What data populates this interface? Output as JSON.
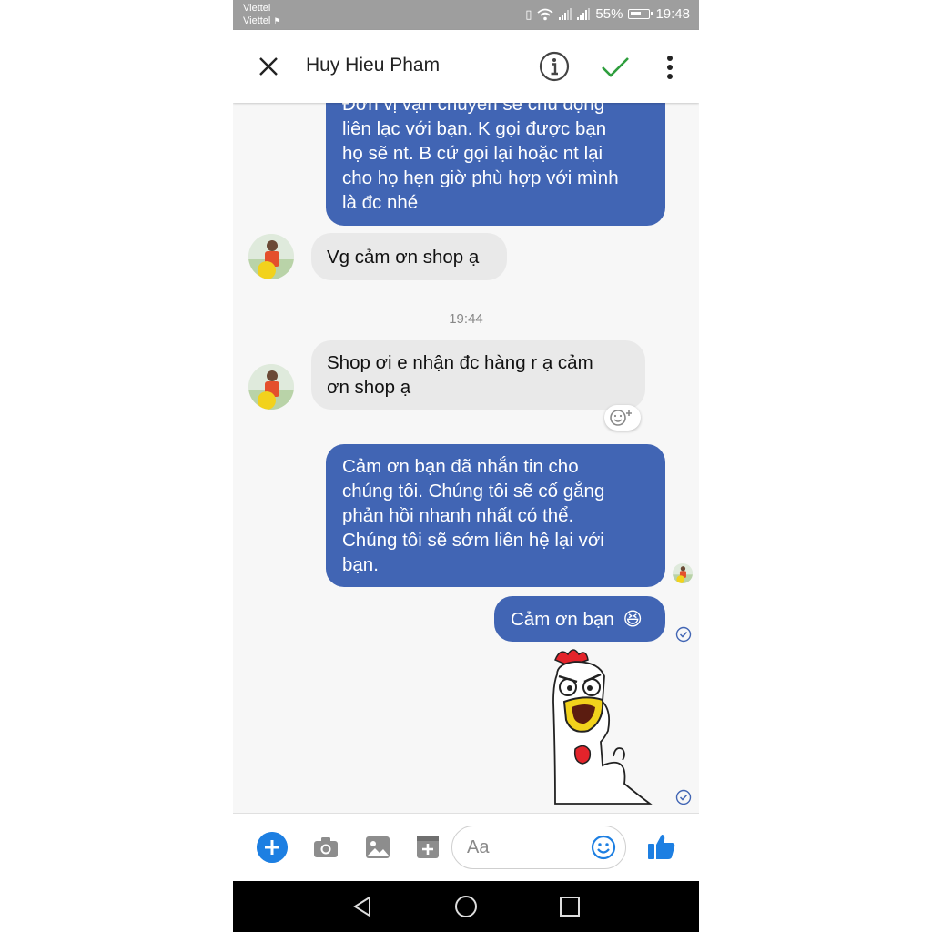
{
  "status_bar": {
    "carrier_1": "Viettel",
    "carrier_2": "Viettel",
    "battery": "55%",
    "time": "19:48"
  },
  "header": {
    "contact_name": "Huy Hieu Pham"
  },
  "messages": [
    {
      "side": "outgoing",
      "text": [
        "Đơn vị vận chuyển sẽ chủ động",
        "liên lạc với bạn. K gọi được bạn",
        "họ sẽ nt. B cứ gọi lại hoặc nt lại",
        "cho họ hẹn giờ phù hợp với mình",
        "là đc nhé"
      ]
    },
    {
      "side": "incoming",
      "text": [
        "Vg cảm ơn shop ạ"
      ]
    },
    {
      "side": "incoming",
      "text": [
        "Shop ơi e nhận đc hàng r ạ cảm",
        "ơn shop ạ"
      ]
    },
    {
      "side": "outgoing",
      "text": [
        "Cảm ơn bạn đã nhắn tin cho",
        "chúng tôi. Chúng tôi sẽ cố gắng",
        "phản hồi nhanh nhất có thể.",
        "Chúng tôi sẽ sớm liên hệ lại với",
        "bạn."
      ]
    },
    {
      "side": "outgoing",
      "text": [
        "Cảm ơn bạn"
      ],
      "emoji": "😆"
    }
  ],
  "timestamp": "19:44",
  "composer": {
    "placeholder": "Aa"
  },
  "colors": {
    "outgoing_bubble": "#4165b4",
    "incoming_bubble": "#e9e9e9",
    "accent": "#1d7fe2",
    "check": "#2e9e3d"
  },
  "icons": [
    "close-icon",
    "info-icon",
    "check-icon",
    "more-icon",
    "plus-icon",
    "camera-icon",
    "image-icon",
    "sticker-icon",
    "emoji-icon",
    "like-icon",
    "back-icon",
    "home-icon",
    "recents-icon"
  ]
}
